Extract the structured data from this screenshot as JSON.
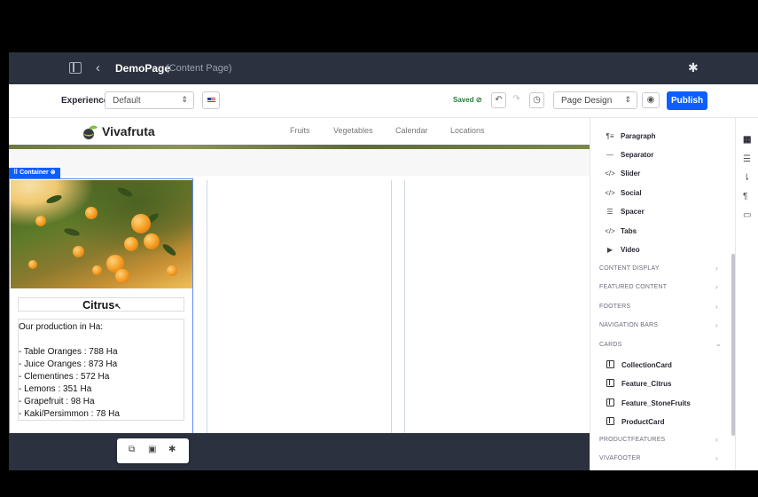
{
  "topbar": {
    "title": "DemoPage",
    "subtitle": "(Content Page)",
    "back_icon": "chevron-left-icon",
    "settings_icon": "gear-icon"
  },
  "toolbar": {
    "experience_label": "Experience",
    "experience_value": "Default",
    "language_flag": "en-US",
    "saved_text": "Saved",
    "mode_value": "Page Design",
    "publish_label": "Publish"
  },
  "site": {
    "logo_text": "Vivafruta",
    "nav": [
      "Fruits",
      "Vegetables",
      "Calendar",
      "Locations"
    ]
  },
  "container": {
    "tag_label": "Container",
    "card_title": "Citrus",
    "body_lines": [
      "Our production in Ha:",
      "",
      "- Table Oranges : 788 Ha",
      "- Juice Oranges : 873 Ha",
      "- Clementines : 572 Ha",
      "- Lemons : 351 Ha",
      "- Grapefruit : 98 Ha",
      "- Kaki/Persimmon : 78 Ha"
    ]
  },
  "panel": {
    "basic_items": [
      {
        "icon": "paragraph-icon",
        "label": "Paragraph"
      },
      {
        "icon": "separator-icon",
        "label": "Separator"
      },
      {
        "icon": "code-icon",
        "label": "Slider"
      },
      {
        "icon": "code-icon",
        "label": "Social"
      },
      {
        "icon": "spacer-icon",
        "label": "Spacer"
      },
      {
        "icon": "code-icon",
        "label": "Tabs"
      },
      {
        "icon": "video-icon",
        "label": "Video"
      }
    ],
    "sections_collapsed": [
      "CONTENT DISPLAY",
      "FEATURED CONTENT",
      "FOOTERS",
      "NAVIGATION BARS"
    ],
    "cards_section": "CARDS",
    "card_items": [
      "CollectionCard",
      "Feature_Citrus",
      "Feature_StoneFruits",
      "ProductCard"
    ],
    "sections_after": [
      "PRODUCTFEATURES",
      "VIVAFOOTER"
    ]
  },
  "colors": {
    "primary": "#0b5fff",
    "dark_bar": "#2b313e",
    "saved_green": "#287d3c"
  }
}
